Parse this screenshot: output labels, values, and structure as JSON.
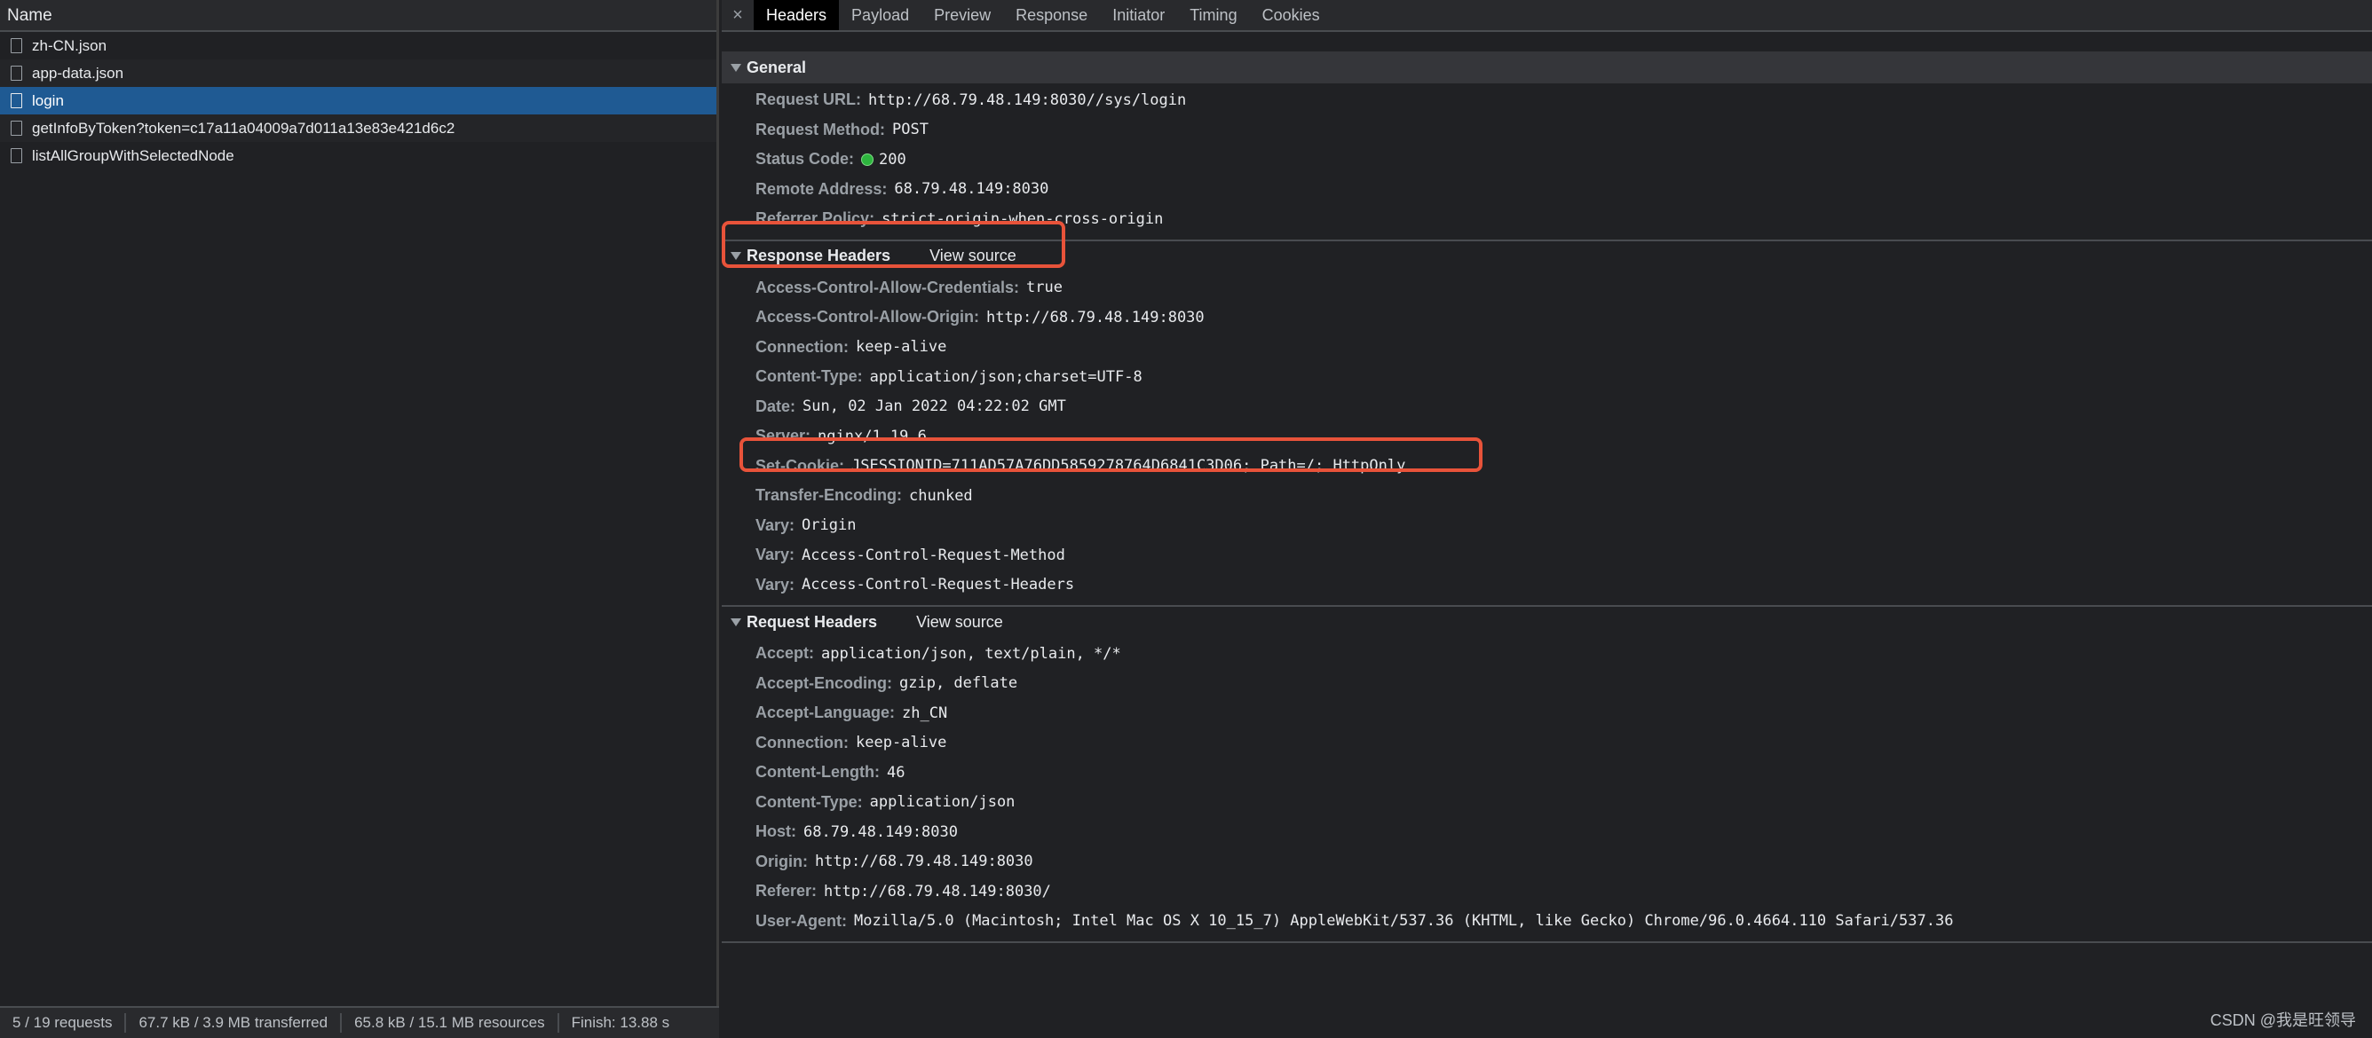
{
  "left": {
    "header": "Name",
    "requests": [
      {
        "name": "zh-CN.json",
        "selected": false
      },
      {
        "name": "app-data.json",
        "selected": false
      },
      {
        "name": "login",
        "selected": true
      },
      {
        "name": "getInfoByToken?token=c17a11a04009a7d011a13e83e421d6c2",
        "selected": false
      },
      {
        "name": "listAllGroupWithSelectedNode",
        "selected": false
      }
    ],
    "status": {
      "requests": "5 / 19 requests",
      "transferred": "67.7 kB / 3.9 MB transferred",
      "resources": "65.8 kB / 15.1 MB resources",
      "finish": "Finish: 13.88 s"
    }
  },
  "tabs": {
    "close": "×",
    "items": [
      "Headers",
      "Payload",
      "Preview",
      "Response",
      "Initiator",
      "Timing",
      "Cookies"
    ],
    "active": "Headers"
  },
  "general": {
    "title": "General",
    "request_url_key": "Request URL:",
    "request_url": "http://68.79.48.149:8030//sys/login",
    "method_key": "Request Method:",
    "method": "POST",
    "status_key": "Status Code:",
    "status": "200",
    "remote_key": "Remote Address:",
    "remote": "68.79.48.149:8030",
    "referrer_key": "Referrer Policy:",
    "referrer": "strict-origin-when-cross-origin"
  },
  "response_headers": {
    "title": "Response Headers",
    "view_source": "View source",
    "rows": [
      {
        "k": "Access-Control-Allow-Credentials:",
        "v": "true"
      },
      {
        "k": "Access-Control-Allow-Origin:",
        "v": "http://68.79.48.149:8030"
      },
      {
        "k": "Connection:",
        "v": "keep-alive"
      },
      {
        "k": "Content-Type:",
        "v": "application/json;charset=UTF-8"
      },
      {
        "k": "Date:",
        "v": "Sun, 02 Jan 2022 04:22:02 GMT"
      },
      {
        "k": "Server:",
        "v": "nginx/1.19.6"
      },
      {
        "k": "Set-Cookie:",
        "v": "JSESSIONID=711AD57A76DD5859278764D6841C3D06; Path=/; HttpOnly"
      },
      {
        "k": "Transfer-Encoding:",
        "v": "chunked"
      },
      {
        "k": "Vary:",
        "v": "Origin"
      },
      {
        "k": "Vary:",
        "v": "Access-Control-Request-Method"
      },
      {
        "k": "Vary:",
        "v": "Access-Control-Request-Headers"
      }
    ]
  },
  "request_headers": {
    "title": "Request Headers",
    "view_source": "View source",
    "rows": [
      {
        "k": "Accept:",
        "v": "application/json, text/plain, */*"
      },
      {
        "k": "Accept-Encoding:",
        "v": "gzip, deflate"
      },
      {
        "k": "Accept-Language:",
        "v": "zh_CN"
      },
      {
        "k": "Connection:",
        "v": "keep-alive"
      },
      {
        "k": "Content-Length:",
        "v": "46"
      },
      {
        "k": "Content-Type:",
        "v": "application/json"
      },
      {
        "k": "Host:",
        "v": "68.79.48.149:8030"
      },
      {
        "k": "Origin:",
        "v": "http://68.79.48.149:8030"
      },
      {
        "k": "Referer:",
        "v": "http://68.79.48.149:8030/"
      },
      {
        "k": "User-Agent:",
        "v": "Mozilla/5.0 (Macintosh; Intel Mac OS X 10_15_7) AppleWebKit/537.36 (KHTML, like Gecko) Chrome/96.0.4664.110 Safari/537.36"
      }
    ]
  },
  "colors": {
    "highlight": "#e8533a",
    "selected_row": "#1f5a93",
    "status_ok": "#2db53e"
  },
  "watermark": "CSDN @我是旺领导"
}
